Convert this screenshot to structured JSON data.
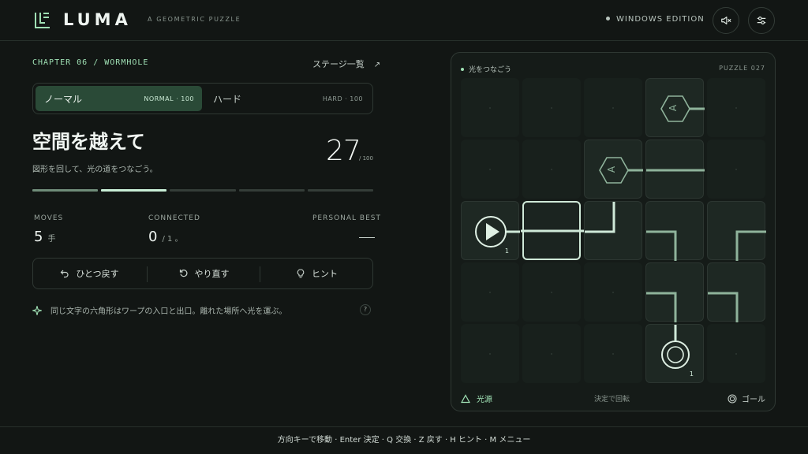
{
  "header": {
    "brand": "LUMA",
    "tagline": "A GEOMETRIC PUZZLE",
    "edition": "WINDOWS EDITION",
    "icons": [
      "luma-logo-icon",
      "sound-muted-icon",
      "settings-sliders-icon"
    ]
  },
  "stage": {
    "chapter": "CHAPTER 06 / WORMHOLE",
    "stage_list_label": "ステージ一覧",
    "stage_list_arrow": "↗",
    "title": "空間を越えて",
    "subtitle": "図形を回して、光の道をつなごう。",
    "score": "27",
    "score_max": "/ 100"
  },
  "difficulty": {
    "selected": "normal",
    "normal_jp": "ノーマル",
    "normal_en": "NORMAL · 100",
    "hard_jp": "ハード",
    "hard_en": "HARD · 100"
  },
  "progress": {
    "total_segments": 5,
    "current_index": 1
  },
  "stats": {
    "moves_label": "MOVES",
    "moves_value": "5",
    "moves_unit": "手",
    "connected_label": "CONNECTED",
    "connected_value": "0",
    "connected_unit": "/ 1 。",
    "best_label": "PERSONAL BEST"
  },
  "actions": {
    "undo": "ひとつ戻す",
    "redo": "やり直す",
    "hint": "ヒント"
  },
  "hint_text": "同じ文字の六角形はワープの入口と出口。離れた場所へ光を運ぶ。",
  "help_label": "?",
  "board": {
    "label": "光をつなごう",
    "puzzle": "PUZZLE 027",
    "warp_letter": "A",
    "source_count": "1",
    "goal_count": "1",
    "foot_left": "光源",
    "foot_center": "決定で回転",
    "foot_right": "ゴール"
  },
  "footer": "方向キーで移動 · Enter 決定 · Q 交換 · Z 戻す · H ヒント · M メニュー",
  "colors": {
    "background": "#121614",
    "accent": "#9fe0b4",
    "selected_fill": "#2a4a37",
    "light_beam": "#cfe9d8",
    "pipe": "#7fa08a"
  }
}
